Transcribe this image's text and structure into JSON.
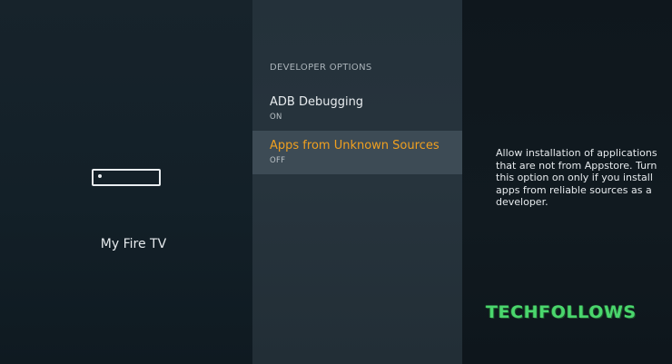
{
  "device": {
    "label": "My Fire TV",
    "icon": "fire-tv-device-icon"
  },
  "developer_options": {
    "header": "DEVELOPER OPTIONS",
    "items": [
      {
        "title": "ADB Debugging",
        "value": "ON",
        "selected": false
      },
      {
        "title": "Apps from Unknown Sources",
        "value": "OFF",
        "selected": true
      }
    ]
  },
  "description": "Allow installation of applications that are not from Appstore. Turn this option on only if you install apps from reliable sources as a developer.",
  "watermark": "TECHFOLLOWS",
  "colors": {
    "selected_text": "#f0a020",
    "selected_background": "#3d4b55",
    "watermark": "#4ad66d"
  }
}
